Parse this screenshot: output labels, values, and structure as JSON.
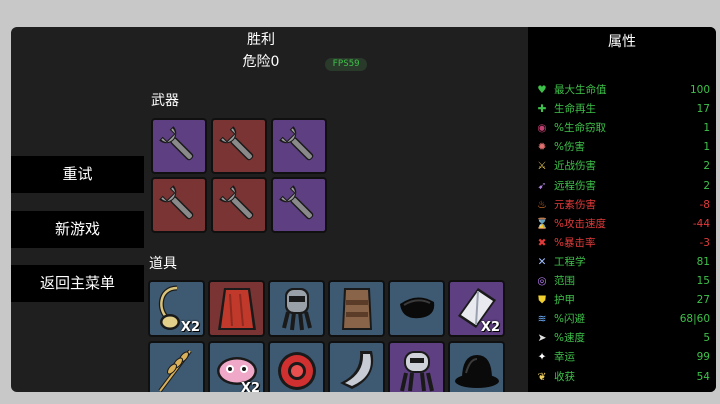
{
  "header": {
    "title": "胜利",
    "subtitle": "危险0",
    "fps": "FPS59"
  },
  "sections": {
    "weapons": "武器",
    "items": "道具"
  },
  "menu": {
    "retry": "重试",
    "new_game": "新游戏",
    "main_menu": "返回主菜单"
  },
  "weapons": [
    {
      "name": "wrench",
      "tier": "purple"
    },
    {
      "name": "wrench",
      "tier": "red"
    },
    {
      "name": "wrench",
      "tier": "purple"
    },
    {
      "name": "wrench",
      "tier": "red"
    },
    {
      "name": "wrench",
      "tier": "red"
    },
    {
      "name": "wrench",
      "tier": "purple"
    }
  ],
  "items": [
    {
      "name": "pendant",
      "qty": "X2"
    },
    {
      "name": "cape",
      "qty": ""
    },
    {
      "name": "robot-mask",
      "qty": ""
    },
    {
      "name": "leather-armor",
      "qty": ""
    },
    {
      "name": "black-stone",
      "qty": ""
    },
    {
      "name": "crystal",
      "qty": "X2"
    },
    {
      "name": "wheat",
      "qty": ""
    },
    {
      "name": "pink-creature",
      "qty": "X2"
    },
    {
      "name": "red-disc",
      "qty": ""
    },
    {
      "name": "horn",
      "qty": ""
    },
    {
      "name": "robot-head",
      "qty": ""
    },
    {
      "name": "bowler-hat",
      "qty": ""
    }
  ],
  "stats": {
    "title": "属性",
    "rows": [
      {
        "icon": "heart-icon",
        "label": "最大生命值",
        "value": "100",
        "color": "#3ec14a"
      },
      {
        "icon": "regen-icon",
        "label": "生命再生",
        "value": "17",
        "color": "#3ec14a"
      },
      {
        "icon": "lifesteal-icon",
        "label": "%生命窃取",
        "value": "1",
        "color": "#3ec14a"
      },
      {
        "icon": "damage-icon",
        "label": "%伤害",
        "value": "1",
        "color": "#3ec14a"
      },
      {
        "icon": "melee-icon",
        "label": "近战伤害",
        "value": "2",
        "color": "#3ec14a"
      },
      {
        "icon": "ranged-icon",
        "label": "远程伤害",
        "value": "2",
        "color": "#3ec14a"
      },
      {
        "icon": "elemental-icon",
        "label": "元素伤害",
        "value": "-8",
        "color": "#e03a3a"
      },
      {
        "icon": "hourglass-icon",
        "label": "%攻击速度",
        "value": "-44",
        "color": "#e03a3a"
      },
      {
        "icon": "crit-icon",
        "label": "%暴击率",
        "value": "-3",
        "color": "#e03a3a"
      },
      {
        "icon": "engineering-icon",
        "label": "工程学",
        "value": "81",
        "color": "#3ec14a"
      },
      {
        "icon": "range-icon",
        "label": "范围",
        "value": "15",
        "color": "#3ec14a"
      },
      {
        "icon": "armor-icon",
        "label": "护甲",
        "value": "27",
        "color": "#3ec14a"
      },
      {
        "icon": "dodge-icon",
        "label": "%闪避",
        "value": "68|60",
        "color": "#3ec14a"
      },
      {
        "icon": "speed-icon",
        "label": "%速度",
        "value": "5",
        "color": "#3ec14a"
      },
      {
        "icon": "luck-icon",
        "label": "幸运",
        "value": "99",
        "color": "#3ec14a"
      },
      {
        "icon": "harvest-icon",
        "label": "收获",
        "value": "54",
        "color": "#3ec14a"
      }
    ]
  }
}
